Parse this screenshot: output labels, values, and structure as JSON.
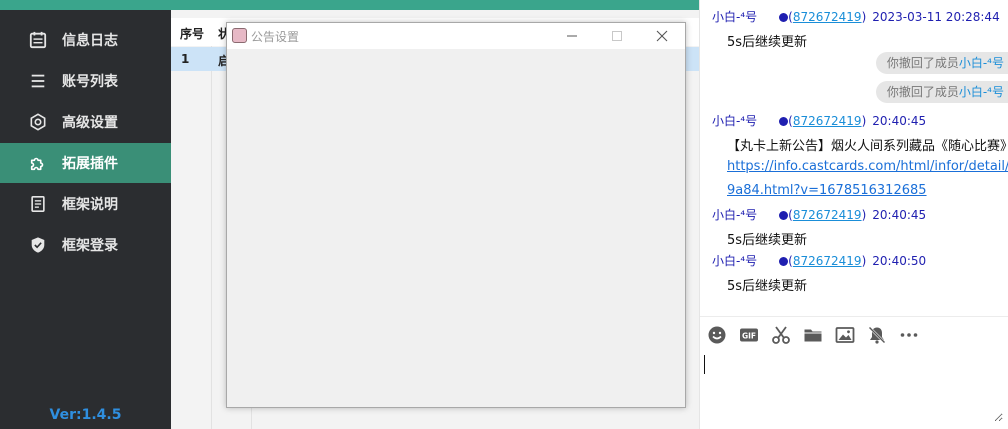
{
  "sidebar": {
    "items": [
      {
        "label": "信息日志",
        "icon": "calendar-icon",
        "active": false
      },
      {
        "label": "账号列表",
        "icon": "list-icon",
        "active": false
      },
      {
        "label": "高级设置",
        "icon": "gear-icon",
        "active": false
      },
      {
        "label": "拓展插件",
        "icon": "puzzle-icon",
        "active": true
      },
      {
        "label": "框架说明",
        "icon": "document-icon",
        "active": false
      },
      {
        "label": "框架登录",
        "icon": "shield-check-icon",
        "active": false
      }
    ],
    "version": "Ver:1.4.5"
  },
  "table": {
    "headers": [
      "序号",
      "状"
    ],
    "rows": [
      [
        "1",
        "启"
      ]
    ]
  },
  "dialog": {
    "title": "公告设置",
    "icon": "app-avatar-icon"
  },
  "chat": {
    "messages": [
      {
        "nick": "小白-⁴号",
        "qq": "872672419",
        "time": "2023-03-11 20:28:44",
        "body": "5s后继续更新"
      },
      {
        "nick": "小白-⁴号",
        "qq": "872672419",
        "time": "20:40:45",
        "body": "【丸卡上新公告】烟火人间系列藏品《随心比赛》",
        "link1": "https://info.castcards.com/html/infor/detail/in",
        "link2": "9a84.html?v=1678516312685"
      },
      {
        "nick": "小白-⁴号",
        "qq": "872672419",
        "time": "20:40:45",
        "body": "5s后继续更新"
      },
      {
        "nick": "小白-⁴号",
        "qq": "872672419",
        "time": "20:40:50",
        "body": "5s后继续更新"
      }
    ],
    "recalls": [
      {
        "prefix": "你撤回了成员",
        "member": "小白-⁴号"
      },
      {
        "prefix": "你撤回了成员",
        "member": "小白-⁴号"
      }
    ],
    "toolbar": [
      "emoji-icon",
      "gif-icon",
      "scissors-icon",
      "folder-icon",
      "image-icon",
      "bell-off-icon",
      "more-icon"
    ],
    "input_value": ""
  },
  "colors": {
    "sidebar_bg": "#2b2d30",
    "accent": "#3a8f77",
    "version": "#2f8fe0",
    "nick": "#1f1fb0",
    "link": "#1a8ed8"
  }
}
